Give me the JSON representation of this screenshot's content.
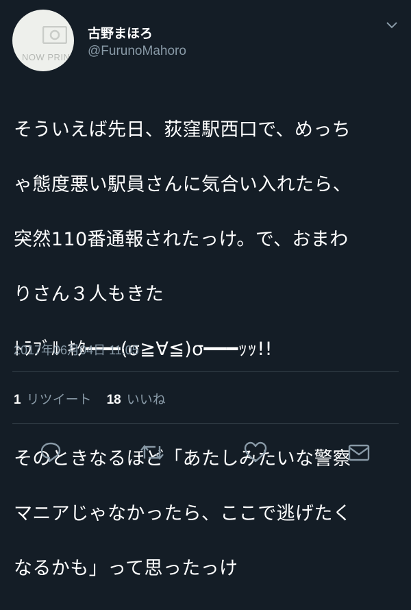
{
  "profile": {
    "display_name": "古野まほろ",
    "handle": "@FurunoMahoro",
    "avatar_text": "NOW PRIN"
  },
  "tweet": {
    "lines": [
      "そういえば先日、荻窪駅西口で、めっち",
      "ゃ態度悪い駅員さんに気合い入れたら、",
      "突然110番通報されたっけ。で、おまわ",
      "りさん３人もきた",
      "ﾄﾗﾌﾞﾙ ｷﾀ━━━(σ≧∀≦)σ━━━ｯｯ!!",
      "",
      "そのときなるほど「あたしみたいな警察",
      "マニアじゃなかったら、ここで逃げたく",
      "なるかも」って思ったっけ"
    ],
    "timestamp": "2017年06月04日 11:05"
  },
  "stats": {
    "retweet_count": "1",
    "retweet_label": "リツイート",
    "like_count": "18",
    "like_label": "いいね"
  },
  "icons": {
    "menu": "chevron-down-icon",
    "reply": "reply-icon",
    "retweet": "retweet-icon",
    "like": "heart-icon",
    "dm": "envelope-icon"
  },
  "colors": {
    "background": "#141d26",
    "secondary_text": "#8899a6",
    "divider": "#38444d"
  }
}
